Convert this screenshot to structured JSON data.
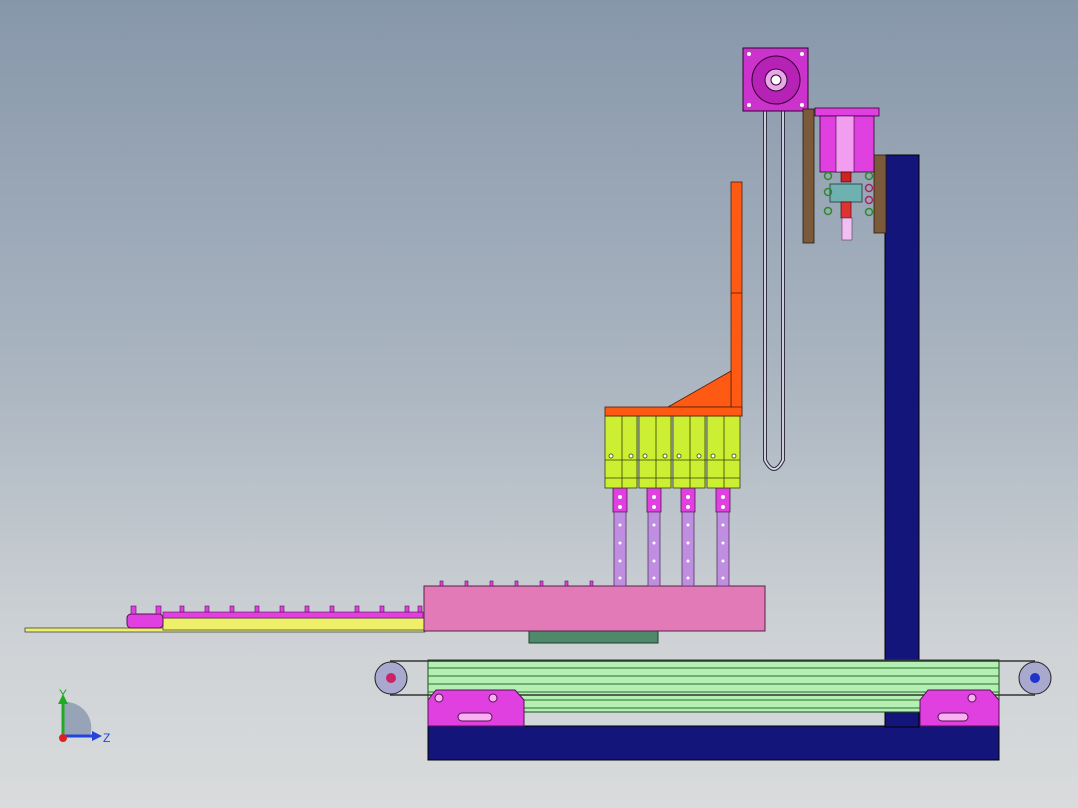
{
  "viewport": {
    "background_top": "#8797aa",
    "background_bottom": "#d9dbdc"
  },
  "colors": {
    "frame_blue": "#14157a",
    "motor_magenta": "#cc33cc",
    "bracket_orange": "#ff5a14",
    "slider_lime": "#ccee33",
    "conveyor_green": "#b4f0b4",
    "plate_pink": "#e27ab8",
    "rail_yellow": "#eef06a",
    "rod_purple": "#c08ee0",
    "mount_brown": "#7a5a3a"
  },
  "triad": {
    "y_label": "Y",
    "z_label": "Z",
    "y_color": "#22aa22",
    "z_color": "#2244dd",
    "origin_color": "#dd2222"
  }
}
